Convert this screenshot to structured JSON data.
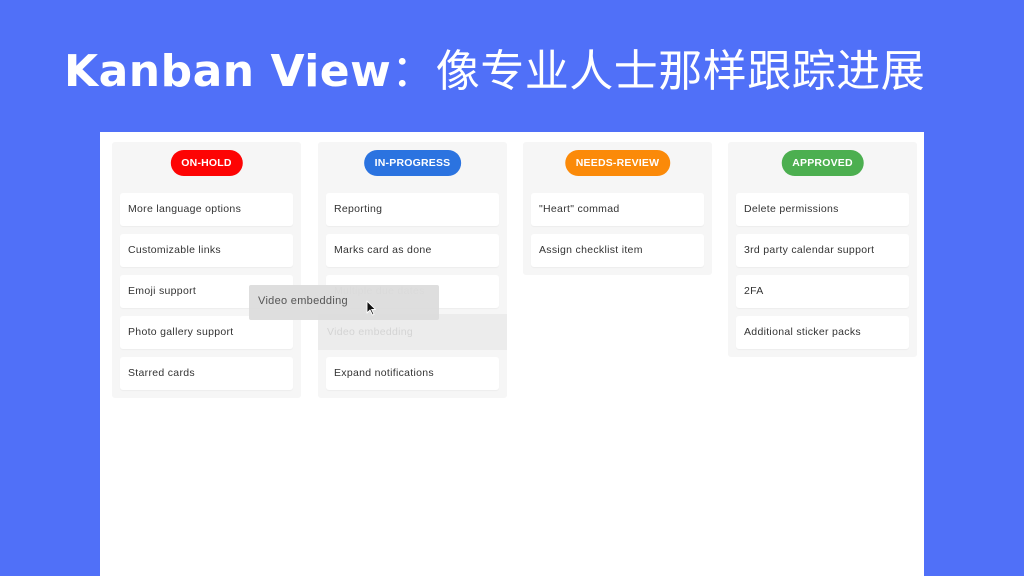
{
  "headline": {
    "title": "Kanban View",
    "subtitle": "：像专业人士那样跟踪进展"
  },
  "colors": {
    "background": "#5070f8",
    "panel": "#ffffff",
    "on_hold": "#fd0404",
    "in_progress": "#2b73e0",
    "needs_review": "#fb8a09",
    "approved": "#4caf50"
  },
  "columns": [
    {
      "status": "ON-HOLD",
      "color": "#fd0404",
      "cards": [
        "More language options",
        "Customizable links",
        "Emoji support",
        "Photo gallery support",
        "Starred cards"
      ]
    },
    {
      "status": "IN-PROGRESS",
      "color": "#2b73e0",
      "cards": [
        "Reporting",
        "Marks card as done",
        "Multiple due dates",
        "Expand notifications"
      ],
      "drop_placeholder": "Video embedding"
    },
    {
      "status": "NEEDS-REVIEW",
      "color": "#fb8a09",
      "cards": [
        "\"Heart\" commad",
        "Assign checklist item"
      ]
    },
    {
      "status": "APPROVED",
      "color": "#4caf50",
      "cards": [
        "Delete permissions",
        "3rd party calendar support",
        "2FA",
        "Additional sticker packs"
      ]
    }
  ],
  "drag": {
    "label": "Video embedding",
    "cursor_icon": "arrow-cursor-icon"
  }
}
